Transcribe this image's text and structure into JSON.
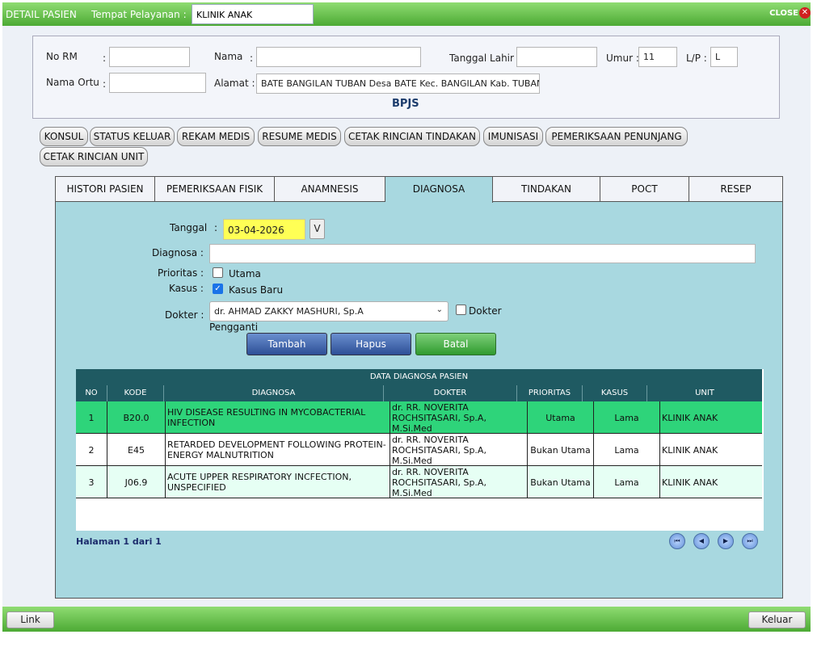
{
  "titlebar": {
    "title": "DETAIL PASIEN",
    "service_label": "Tempat Pelayanan :",
    "service_value": "KLINIK ANAK",
    "close_label": "CLOSE"
  },
  "patient": {
    "no_rm_label": "No RM",
    "colon": ":",
    "no_rm_value": "",
    "nama_label": "Nama",
    "nama_value": "",
    "tgl_lahir_label": "Tanggal Lahir :",
    "tgl_lahir_value": "",
    "umur_label": "Umur :",
    "umur_value": "11",
    "lp_label": "L/P :",
    "lp_value": "L",
    "nama_ortu_label": "Nama Ortu",
    "nama_ortu_value": "",
    "alamat_label": "Alamat :",
    "alamat_value": "BATE BANGILAN TUBAN Desa BATE Kec. BANGILAN Kab. TUBAN",
    "insurance": "BPJS"
  },
  "action_buttons": [
    "KONSUL",
    "STATUS KELUAR",
    "REKAM MEDIS",
    "RESUME MEDIS",
    "CETAK RINCIAN TINDAKAN",
    "IMUNISASI",
    "PEMERIKSAAN PENUNJANG",
    "CETAK RINCIAN UNIT"
  ],
  "tabs": [
    "HISTORI PASIEN",
    "PEMERIKSAAN FISIK",
    "ANAMNESIS",
    "DIAGNOSA",
    "TINDAKAN",
    "POCT",
    "RESEP"
  ],
  "form": {
    "tanggal_label": "Tanggal",
    "tanggal_value": "03-04-2026",
    "v_label": "V",
    "diagnosa_label": "Diagnosa :",
    "diagnosa_value": "",
    "prioritas_label": "Prioritas :",
    "utama_label": "Utama",
    "kasus_label": "Kasus :",
    "kasus_baru_label": "Kasus Baru",
    "dokter_label": "Dokter :",
    "dokter_value": "dr. AHMAD ZAKKY MASHURI, Sp.A",
    "dokter_pengganti_label": "Dokter",
    "pengganti_label": "Pengganti",
    "tambah": "Tambah",
    "hapus": "Hapus",
    "batal": "Batal"
  },
  "grid": {
    "title": "DATA DIAGNOSA PASIEN",
    "columns": [
      "NO",
      "KODE",
      "DIAGNOSA",
      "DOKTER",
      "PRIORITAS",
      "KASUS",
      "UNIT"
    ],
    "rows": [
      [
        "1",
        "B20.0",
        "HIV DISEASE RESULTING IN MYCOBACTERIAL INFECTION",
        "dr. RR. NOVERITA ROCHSITASARI, Sp.A, M.Si.Med",
        "Utama",
        "Lama",
        "KLINIK ANAK"
      ],
      [
        "2",
        "E45",
        "RETARDED DEVELOPMENT FOLLOWING PROTEIN-ENERGY MALNUTRITION",
        "dr. RR. NOVERITA ROCHSITASARI, Sp.A, M.Si.Med",
        "Bukan Utama",
        "Lama",
        "KLINIK ANAK"
      ],
      [
        "3",
        "J06.9",
        "ACUTE UPPER RESPIRATORY INCFECTION, UNSPECIFIED",
        "dr. RR. NOVERITA ROCHSITASARI, Sp.A, M.Si.Med",
        "Bukan Utama",
        "Lama",
        "KLINIK ANAK"
      ]
    ],
    "row_colors": [
      "#2ed47a",
      "#ffffff",
      "#e6fff4"
    ],
    "pager": "Halaman 1 dari 1"
  },
  "bottom": {
    "link": "Link",
    "keluar": "Keluar"
  }
}
